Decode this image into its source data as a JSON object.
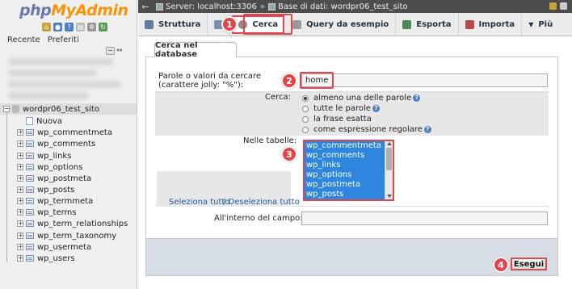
{
  "brand": {
    "part1": "php",
    "part2": "MyAdmin"
  },
  "nav": {
    "links": [
      "Recente",
      "Preferiti"
    ],
    "db_name": "wordpr06_test_sito",
    "new_label": "Nuova",
    "tables": [
      "wp_commentmeta",
      "wp_comments",
      "wp_links",
      "wp_options",
      "wp_postmeta",
      "wp_posts",
      "wp_termmeta",
      "wp_terms",
      "wp_term_relationships",
      "wp_term_taxonomy",
      "wp_usermeta",
      "wp_users"
    ]
  },
  "topbar": {
    "server": "Server: localhost:3306",
    "separator": "»",
    "database": "Base di dati: wordpr06_test_sito"
  },
  "tabs": [
    {
      "label": "Struttura",
      "icon": "structure-icon",
      "color": "#5f7e9e"
    },
    {
      "label": "",
      "icon": "sql-icon",
      "color": "#7a8fb0"
    },
    {
      "label": "Cerca",
      "icon": "search-icon",
      "color": "#8c8c8c",
      "active": true
    },
    {
      "label": "Query da esempio",
      "icon": "query-icon",
      "color": "#9a9a9a"
    },
    {
      "label": "Esporta",
      "icon": "export-icon",
      "color": "#4d8a56"
    },
    {
      "label": "Importa",
      "icon": "import-icon",
      "color": "#b64a4a"
    },
    {
      "label": "Più",
      "icon": "more-icon",
      "color": "#444444"
    }
  ],
  "form": {
    "section_title": "Cerca nel database",
    "words_label": "Parole o valori da cercare (carattere jolly: \"%\"):",
    "words_value": "home",
    "search_label": "Cerca:",
    "search_options": [
      "almeno una delle parole",
      "tutte le parole",
      "la frase esatta",
      "come espressione regolare"
    ],
    "search_selected": 0,
    "tables_label": "Nelle tabelle:",
    "tables_visible": [
      "wp_commentmeta",
      "wp_comments",
      "wp_links",
      "wp_options",
      "wp_postmeta",
      "wp_posts"
    ],
    "select_all": "Seleziona tutto",
    "deselect_all": "/ Deseleziona tutto",
    "field_label": "All'interno del campo:",
    "field_value": "",
    "go_button": "Esegui"
  },
  "callouts": [
    "1",
    "2",
    "3",
    "4"
  ],
  "colors": {
    "accent": "#e0474c",
    "selection": "#2e86de",
    "topbar": "#4d4d4d"
  }
}
